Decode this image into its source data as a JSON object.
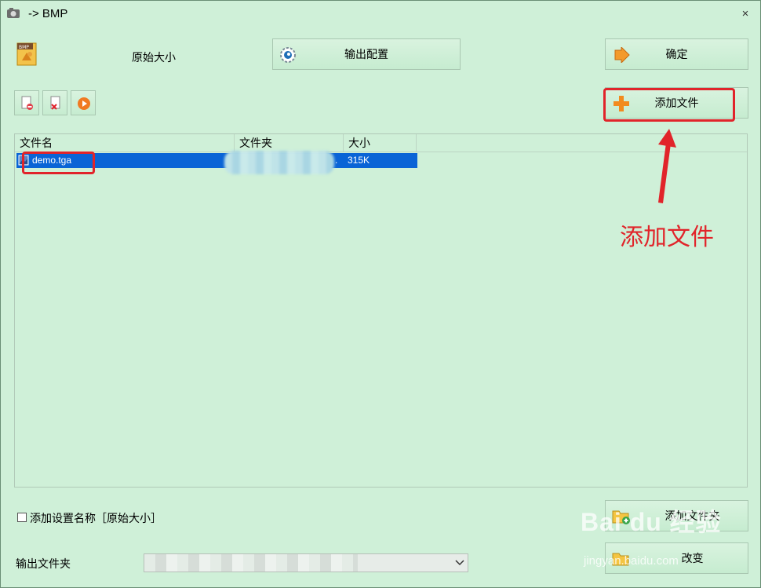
{
  "window": {
    "title": "-> BMP",
    "close_symbol": "×"
  },
  "header": {
    "size_label": "原始大小",
    "output_config_button": "输出配置",
    "confirm_button": "确定",
    "add_file_button": "添加文件"
  },
  "file_list": {
    "columns": [
      "文件名",
      "文件夹",
      "大小"
    ],
    "rows": [
      {
        "name": "demo.tga",
        "folder_suffix": ".",
        "size": "315K"
      }
    ]
  },
  "annotation": {
    "text": "添加文件",
    "color": "#e1242a"
  },
  "bottom": {
    "add_settings_name_label": "添加设置名称［原始大小］",
    "add_folder_button": "添加文件夹",
    "output_folder_label": "输出文件夹",
    "change_button": "改变"
  },
  "watermark": {
    "logo_text": "Bai du 经验",
    "url": "jingyan.baidu.com"
  },
  "colors": {
    "background": "#cff0d8",
    "selection": "#0a64d6",
    "annotation": "#e1242a"
  }
}
